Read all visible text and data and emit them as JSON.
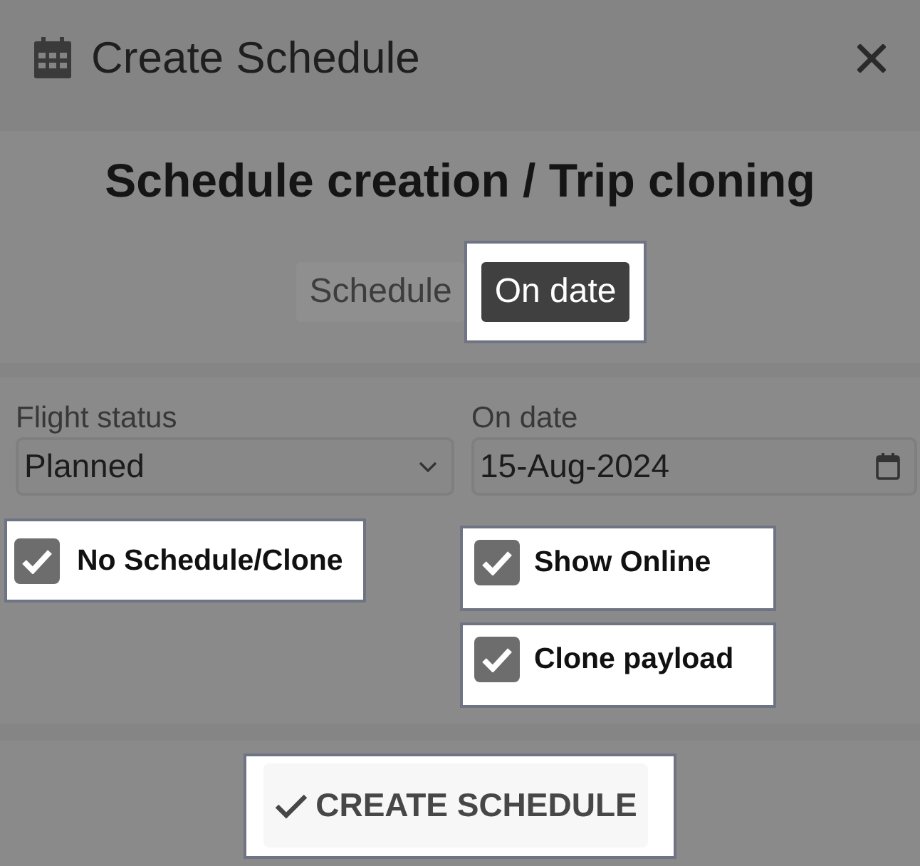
{
  "dialog_header": {
    "title": "Create Schedule"
  },
  "heading": "Schedule creation / Trip cloning",
  "mode_toggle": [
    {
      "label": "Schedule",
      "selected": false,
      "highlighted": false
    },
    {
      "label": "On date",
      "selected": true,
      "highlighted": true
    }
  ],
  "fields": [
    {
      "kind": "select",
      "label": "Flight status",
      "value": "Planned"
    },
    {
      "kind": "date",
      "label": "On date",
      "value": "15-Aug-2024"
    }
  ],
  "checkbox_columns": [
    {
      "checkboxes": [
        {
          "label": "No Schedule/Clone",
          "checked": true,
          "highlighted": true
        }
      ]
    },
    {
      "checkboxes": [
        {
          "label": "Show Online",
          "checked": true,
          "highlighted": true
        },
        {
          "label": "Clone payload",
          "checked": true,
          "highlighted": true
        }
      ]
    }
  ],
  "create_button": {
    "label": "CREATE SCHEDULE",
    "highlighted": true
  }
}
